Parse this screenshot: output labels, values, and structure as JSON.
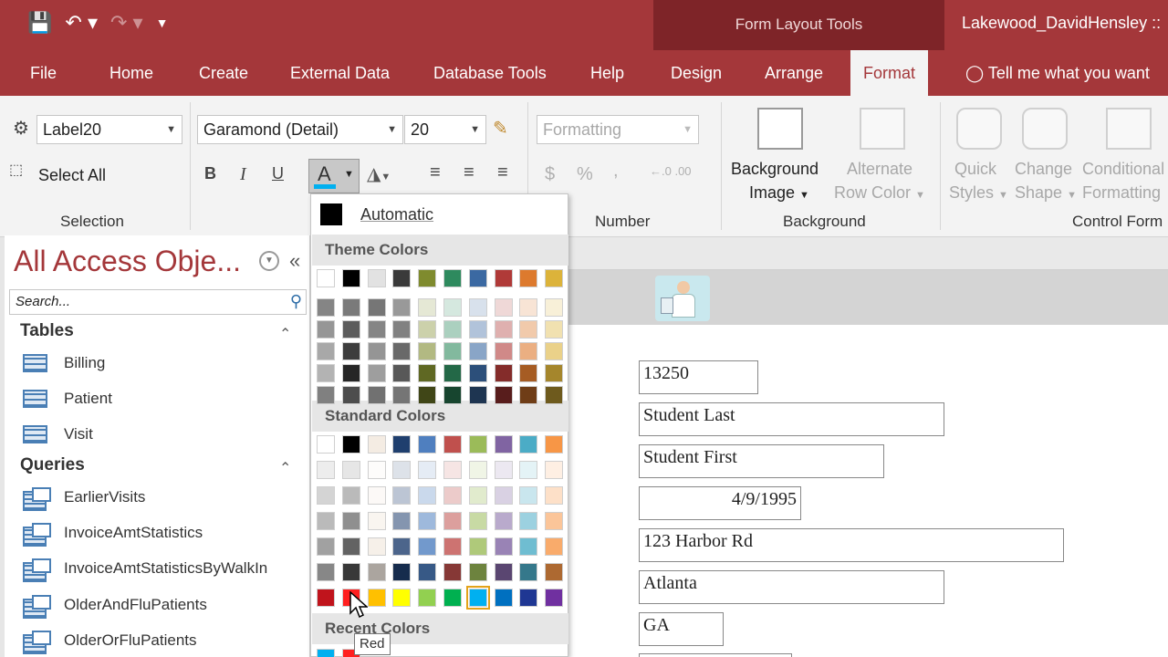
{
  "window": {
    "contextual_title": "Form Layout Tools",
    "doc_title": "Lakewood_DavidHensley ::"
  },
  "tabs": [
    "File",
    "Home",
    "Create",
    "External Data",
    "Database Tools",
    "Help",
    "Design",
    "Arrange",
    "Format"
  ],
  "active_tab": "Format",
  "tell_me": "Tell me what you want",
  "ribbon": {
    "selection": {
      "object_combo": "Label20",
      "select_all": "Select All",
      "group": "Selection"
    },
    "font": {
      "font_name": "Garamond (Detail)",
      "font_size": "20",
      "bold": "B",
      "italic": "I",
      "underline": "U"
    },
    "number": {
      "format_combo": "Formatting",
      "currency": "$",
      "percent": "%",
      "comma": ",",
      "group": "Number"
    },
    "background": {
      "background_image": "Background",
      "background_image_2": "Image",
      "alternate_row": "Alternate",
      "alternate_row_2": "Row Color",
      "group": "Background"
    },
    "control_formatting": {
      "quick_styles": "Quick",
      "quick_styles_2": "Styles",
      "change_shape": "Change",
      "change_shape_2": "Shape",
      "conditional": "Conditional",
      "conditional_2": "Formatting",
      "group": "Control Form"
    }
  },
  "nav": {
    "title": "All Access Obje...",
    "search_placeholder": "Search...",
    "tables_header": "Tables",
    "tables": [
      "Billing",
      "Patient",
      "Visit"
    ],
    "queries_header": "Queries",
    "queries": [
      "EarlierVisits",
      "InvoiceAmtStatistics",
      "InvoiceAmtStatisticsByWalkIn",
      "OlderAndFluPatients",
      "OlderOrFluPatients"
    ]
  },
  "form_fields": [
    "13250",
    "Student Last",
    "Student First",
    "4/9/1995",
    "123 Harbor Rd",
    "Atlanta",
    "GA"
  ],
  "color_menu": {
    "automatic": "Automatic",
    "theme_heading": "Theme Colors",
    "standard_heading": "Standard Colors",
    "recent_heading": "Recent Colors",
    "tooltip": "Red",
    "theme_top": [
      "#ffffff",
      "#000000",
      "#e7e6e6",
      "#44546a",
      "#4472c4",
      "#ed7d31",
      "#a5a5a5",
      "#ffc000",
      "#5b9bd5",
      "#70ad47"
    ],
    "theme_colors": [
      "#ffffff",
      "#000000",
      "#e2e2e2",
      "#3a3a3a",
      "#7f8b2e",
      "#2e8a5e",
      "#3b69a2",
      "#b03a38",
      "#dd7a2e",
      "#dcb33a"
    ],
    "standard_colors": [
      "#ffffff",
      "#000000",
      "#f4ece3",
      "#1f3f6e",
      "#4f7fbf",
      "#c0504d",
      "#9bbb59",
      "#8064a2",
      "#4bacc6",
      "#f79646"
    ],
    "accent_row": [
      "#c0141c",
      "#ff2020",
      "#ffc000",
      "#ffff00",
      "#92d050",
      "#00b050",
      "#00b0f0",
      "#0070c0",
      "#1f3793",
      "#7030a0"
    ],
    "recent_colors": [
      "#00b0f0",
      "#ff2020"
    ],
    "selected_index": 6
  },
  "colors": {
    "brand": "#a4373a",
    "brand_dark": "#7e2428"
  }
}
